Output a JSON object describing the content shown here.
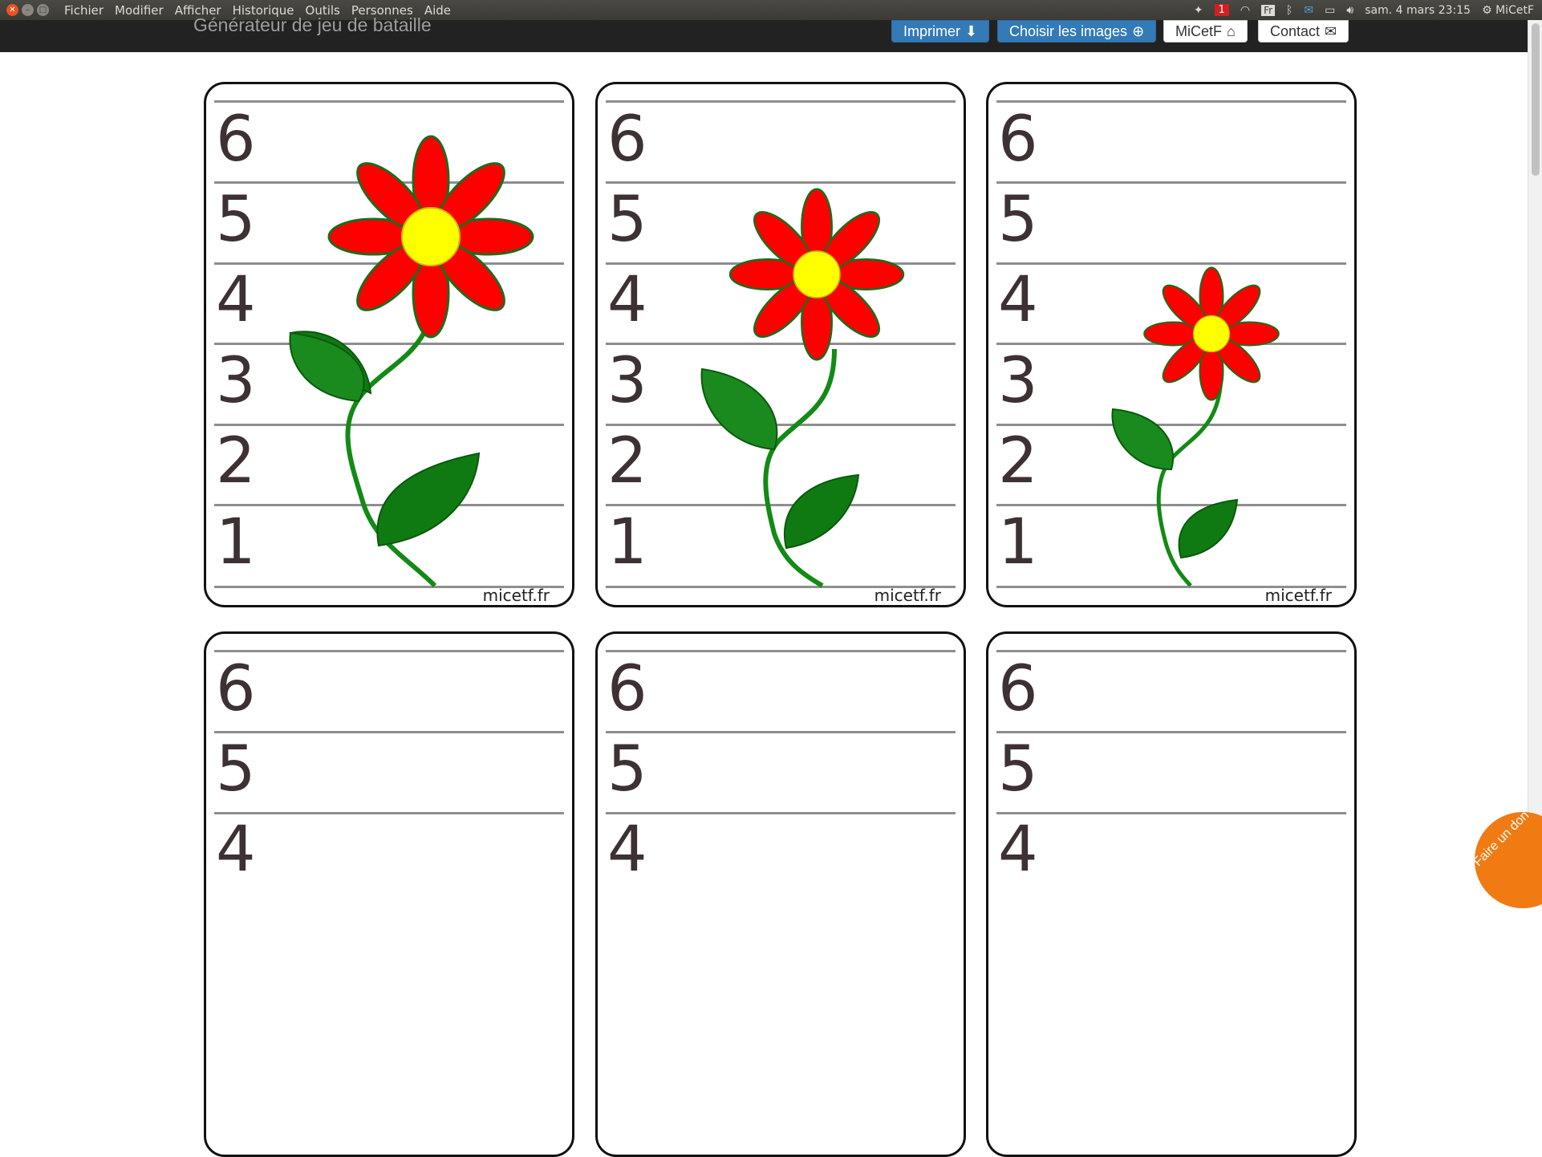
{
  "os_menubar": {
    "menus": [
      "Fichier",
      "Modifier",
      "Afficher",
      "Historique",
      "Outils",
      "Personnes",
      "Aide"
    ],
    "tray": {
      "notification_count": "1",
      "keyboard_layout": "Fr",
      "datetime": "sam. 4 mars 23:15",
      "user": "MiCetF"
    }
  },
  "header": {
    "title": "Générateur de jeu de bataille",
    "buttons": {
      "print": "Imprimer",
      "choose_images": "Choisir les images",
      "home": "MiCetF",
      "contact": "Contact"
    }
  },
  "cards": {
    "brand": "micetf.fr",
    "row_numbers": [
      "6",
      "5",
      "4",
      "3",
      "2",
      "1"
    ],
    "top_row_flower_heights": [
      6,
      5,
      4
    ]
  },
  "donate": {
    "label": "Faire un don"
  },
  "colors": {
    "petal": "#ff0000",
    "center": "#ffff00",
    "leaf": "#0f7a12",
    "stem": "#138a16",
    "button_primary": "#337ab7",
    "donate": "#f07b13"
  }
}
